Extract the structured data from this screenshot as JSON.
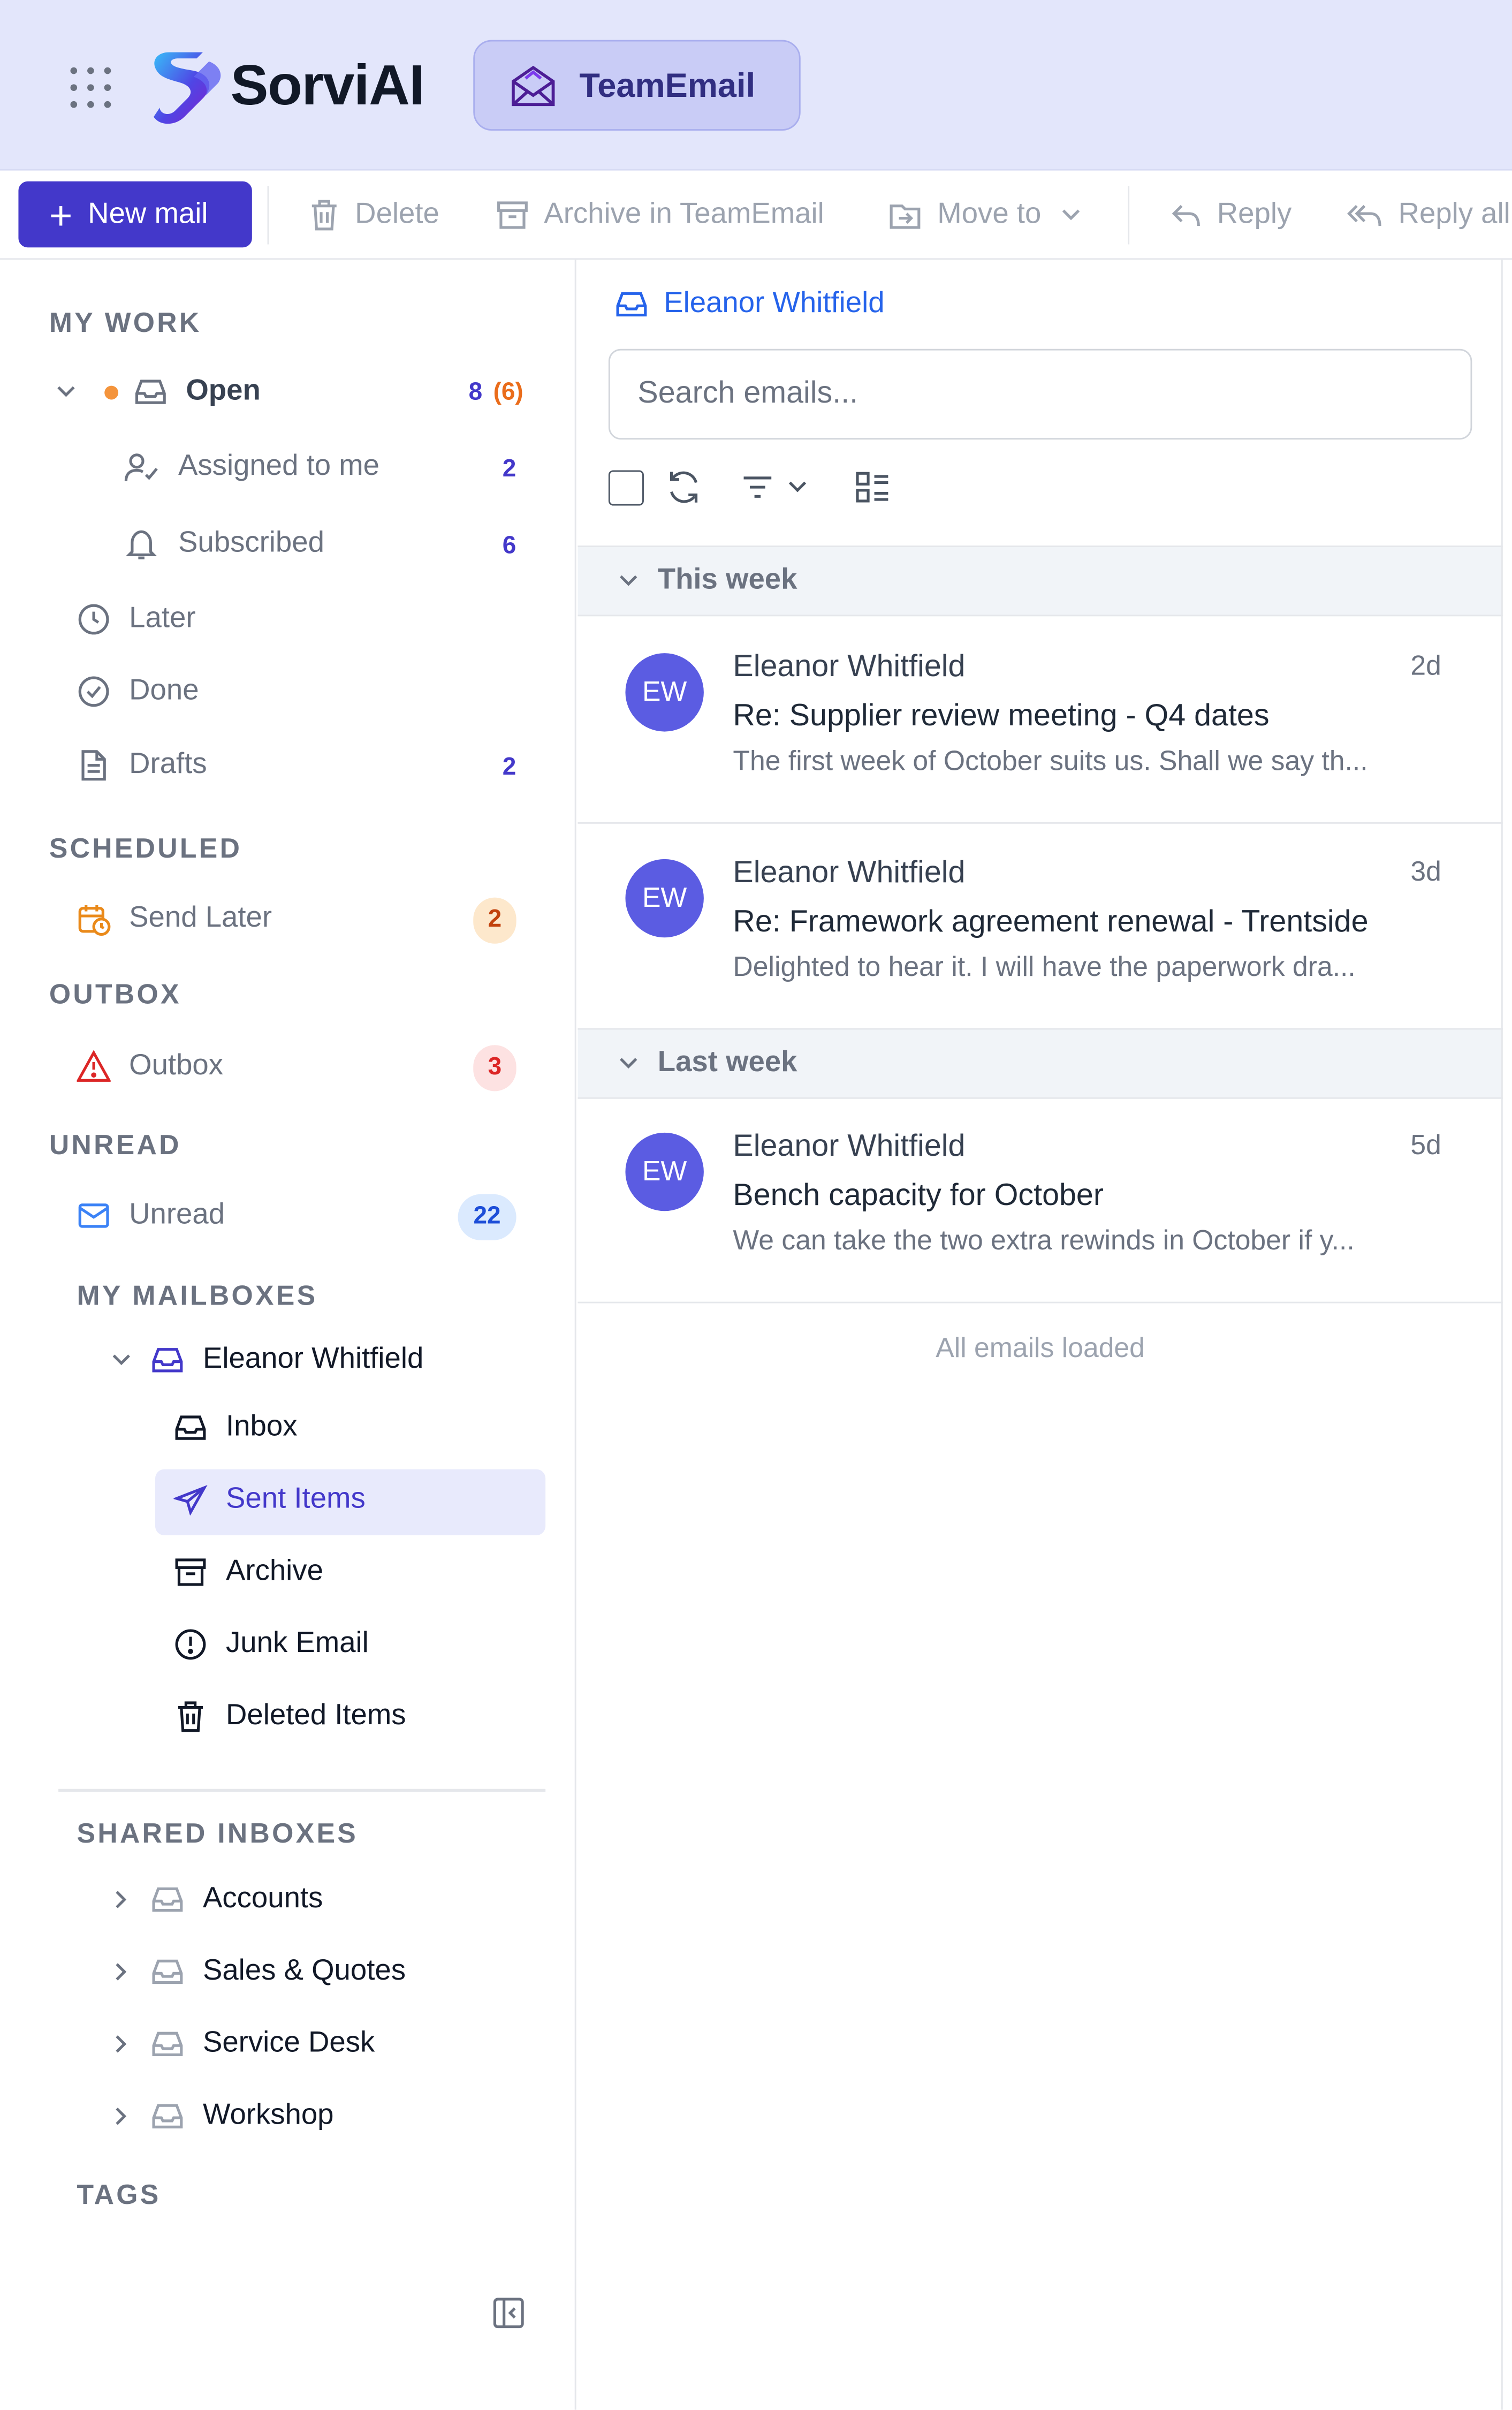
{
  "app": {
    "brand": "SorviAI",
    "product": "TeamEmail"
  },
  "toolbar": {
    "new_mail": "New mail",
    "delete": "Delete",
    "archive": "Archive in TeamEmail",
    "move_to": "Move to",
    "reply": "Reply",
    "reply_all": "Reply all"
  },
  "sidebar": {
    "my_work": {
      "title": "MY WORK",
      "open": {
        "label": "Open",
        "count": "8",
        "count_extra": "(6)"
      },
      "assigned": {
        "label": "Assigned to me",
        "count": "2"
      },
      "subscribed": {
        "label": "Subscribed",
        "count": "6"
      },
      "later": "Later",
      "done": "Done",
      "drafts": {
        "label": "Drafts",
        "count": "2"
      }
    },
    "scheduled": {
      "title": "SCHEDULED",
      "send_later": {
        "label": "Send Later",
        "count": "2"
      }
    },
    "outbox": {
      "title": "OUTBOX",
      "outbox": {
        "label": "Outbox",
        "count": "3"
      }
    },
    "unread": {
      "title": "UNREAD",
      "unread": {
        "label": "Unread",
        "count": "22"
      }
    },
    "my_mailboxes": {
      "title": "MY MAILBOXES",
      "owner": "Eleanor Whitfield",
      "folders": [
        "Inbox",
        "Sent Items",
        "Archive",
        "Junk Email",
        "Deleted Items"
      ],
      "selected": "Sent Items"
    },
    "shared": {
      "title": "SHARED INBOXES",
      "items": [
        "Accounts",
        "Sales & Quotes",
        "Service Desk",
        "Workshop"
      ]
    },
    "tags": {
      "title": "TAGS"
    }
  },
  "main": {
    "mailbox": "Eleanor Whitfield",
    "search_placeholder": "Search emails...",
    "groups": [
      {
        "label": "This week"
      },
      {
        "label": "Last week"
      }
    ],
    "emails": [
      {
        "initials": "EW",
        "from": "Eleanor Whitfield",
        "date": "2d",
        "subject": "Re: Supplier review meeting - Q4 dates",
        "preview": "The first week of October suits us. Shall we say th..."
      },
      {
        "initials": "EW",
        "from": "Eleanor Whitfield",
        "date": "3d",
        "subject": "Re: Framework agreement renewal - Trentside",
        "preview": "Delighted to hear it. I will have the paperwork dra..."
      },
      {
        "initials": "EW",
        "from": "Eleanor Whitfield",
        "date": "5d",
        "subject": "Bench capacity for October",
        "preview": "We can take the two extra rewinds in October if y..."
      }
    ],
    "footer": "All emails loaded"
  },
  "colors": {
    "accent": "#4338ca",
    "header_bg": "#e3e6fb",
    "avatar": "#5b5ce2",
    "orange": "#ea6c1a",
    "red": "#dc2626"
  }
}
